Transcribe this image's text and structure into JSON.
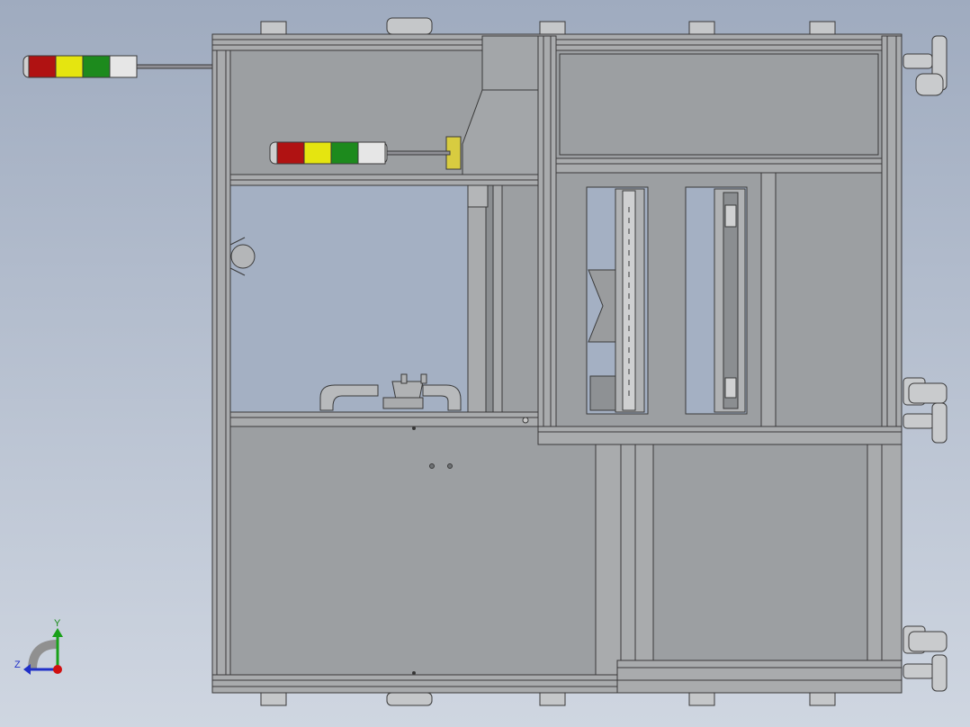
{
  "viewport": {
    "background_top": "#9fabbf",
    "background_bottom": "#cfd6e1"
  },
  "model": {
    "frame_color": "#a9abad",
    "panel_color": "#9c9fa2",
    "edge_color": "#3a3a3a",
    "glass_color": "#a4b0c3"
  },
  "signal_towers": [
    {
      "name": "tower-left",
      "colors": [
        "#b01212",
        "#e5e510",
        "#1d8a1d",
        "#e6e6e6"
      ]
    },
    {
      "name": "tower-inner",
      "colors": [
        "#b01212",
        "#e5e510",
        "#1d8a1d",
        "#e6e6e6"
      ]
    }
  ],
  "triad": {
    "y_label": "Y",
    "z_label": "Z",
    "y_color": "#19a019",
    "z_color": "#2030c8",
    "origin_color": "#d01010"
  }
}
